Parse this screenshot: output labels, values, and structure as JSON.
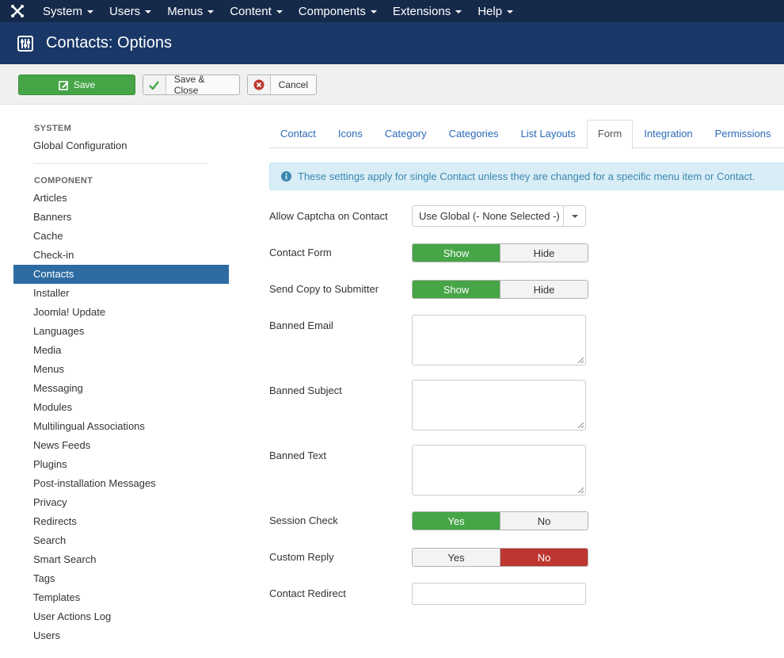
{
  "topnav": {
    "items": [
      {
        "label": "System"
      },
      {
        "label": "Users"
      },
      {
        "label": "Menus"
      },
      {
        "label": "Content"
      },
      {
        "label": "Components"
      },
      {
        "label": "Extensions"
      },
      {
        "label": "Help"
      }
    ]
  },
  "header": {
    "title": "Contacts: Options",
    "icon": "options-icon"
  },
  "toolbar": {
    "save_label": "Save",
    "save_close_label": "Save & Close",
    "cancel_label": "Cancel"
  },
  "sidebar": {
    "system_header": "SYSTEM",
    "global_config": "Global Configuration",
    "component_header": "COMPONENT",
    "items": [
      {
        "label": "Articles"
      },
      {
        "label": "Banners"
      },
      {
        "label": "Cache"
      },
      {
        "label": "Check-in"
      },
      {
        "label": "Contacts"
      },
      {
        "label": "Installer"
      },
      {
        "label": "Joomla! Update"
      },
      {
        "label": "Languages"
      },
      {
        "label": "Media"
      },
      {
        "label": "Menus"
      },
      {
        "label": "Messaging"
      },
      {
        "label": "Modules"
      },
      {
        "label": "Multilingual Associations"
      },
      {
        "label": "News Feeds"
      },
      {
        "label": "Plugins"
      },
      {
        "label": "Post-installation Messages"
      },
      {
        "label": "Privacy"
      },
      {
        "label": "Redirects"
      },
      {
        "label": "Search"
      },
      {
        "label": "Smart Search"
      },
      {
        "label": "Tags"
      },
      {
        "label": "Templates"
      },
      {
        "label": "User Actions Log"
      },
      {
        "label": "Users"
      }
    ],
    "active": "Contacts"
  },
  "tabs": [
    {
      "label": "Contact"
    },
    {
      "label": "Icons"
    },
    {
      "label": "Category"
    },
    {
      "label": "Categories"
    },
    {
      "label": "List Layouts"
    },
    {
      "label": "Form"
    },
    {
      "label": "Integration"
    },
    {
      "label": "Permissions"
    }
  ],
  "active_tab": "Form",
  "alert": {
    "text": "These settings apply for single Contact unless they are changed for a specific menu item or Contact."
  },
  "form": {
    "captcha": {
      "label": "Allow Captcha on Contact",
      "value": "Use Global (- None Selected -)"
    },
    "contact_form": {
      "label": "Contact Form",
      "opt1": "Show",
      "opt2": "Hide",
      "selected": "Show"
    },
    "send_copy": {
      "label": "Send Copy to Submitter",
      "opt1": "Show",
      "opt2": "Hide",
      "selected": "Show"
    },
    "banned_email": {
      "label": "Banned Email",
      "value": ""
    },
    "banned_subject": {
      "label": "Banned Subject",
      "value": ""
    },
    "banned_text": {
      "label": "Banned Text",
      "value": ""
    },
    "session_check": {
      "label": "Session Check",
      "opt1": "Yes",
      "opt2": "No",
      "selected": "Yes"
    },
    "custom_reply": {
      "label": "Custom Reply",
      "opt1": "Yes",
      "opt2": "No",
      "selected": "No"
    },
    "contact_redirect": {
      "label": "Contact Redirect",
      "value": ""
    }
  },
  "colors": {
    "topnav_bg": "#152a4a",
    "header_bg": "#1a3867",
    "success": "#46a546",
    "danger": "#bd362f",
    "active_sidebar": "#2d6ca2",
    "link": "#2a69b8",
    "info_bg": "#d9edf7"
  }
}
